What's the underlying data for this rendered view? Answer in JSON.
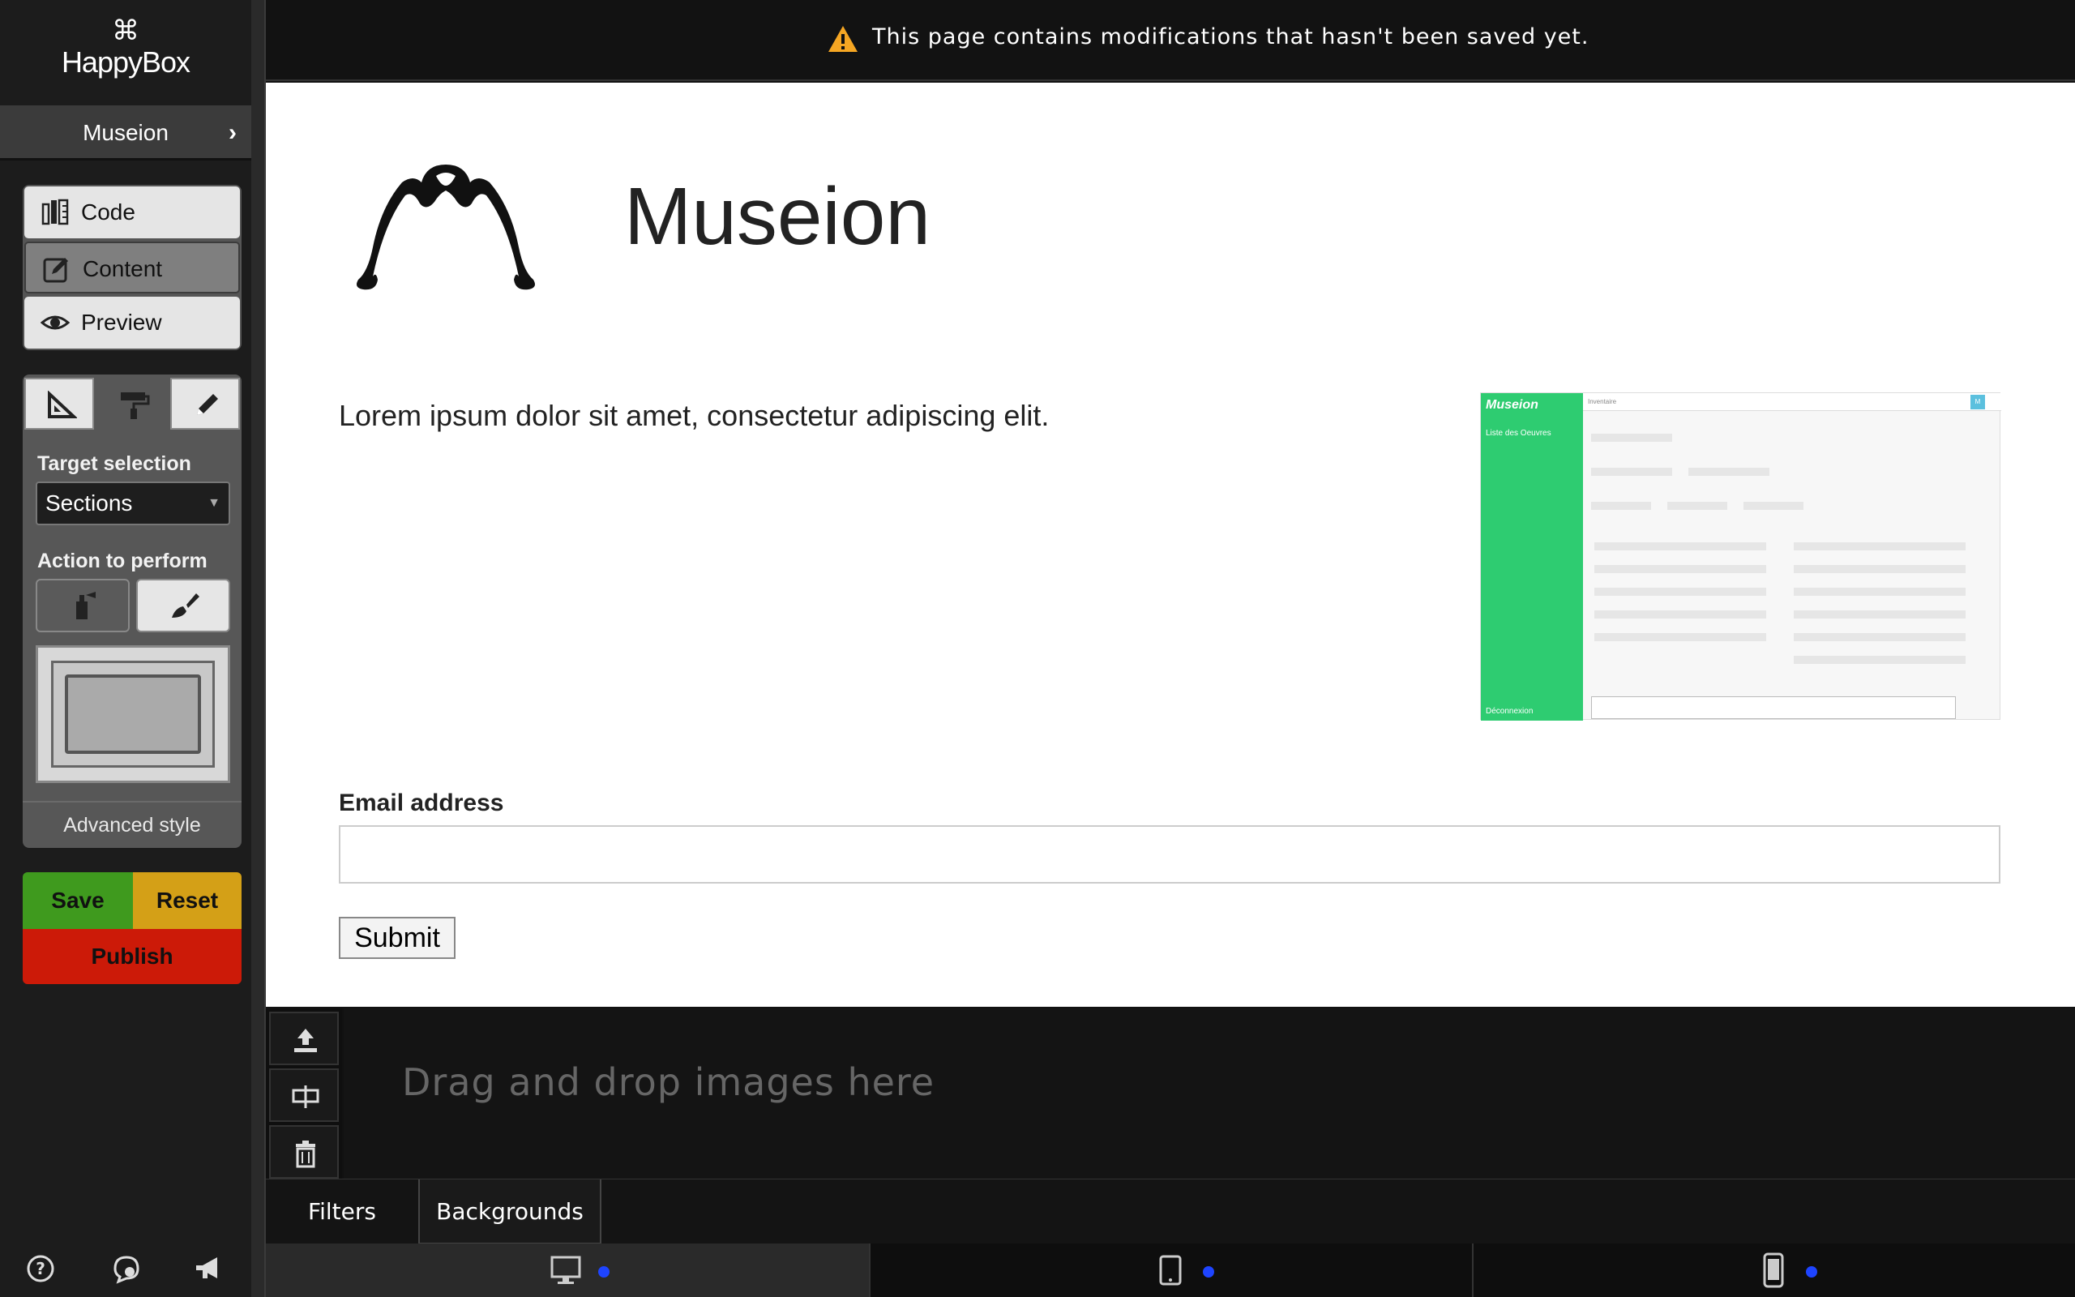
{
  "app": {
    "logo_text": "HappyBox",
    "logo_mark": "⌘"
  },
  "sidebar": {
    "site_name": "Museion",
    "site_chevron": "›",
    "modes": [
      {
        "label": "Code",
        "icon": "code-ruler-icon"
      },
      {
        "label": "Content",
        "icon": "edit-icon"
      },
      {
        "label": "Preview",
        "icon": "eye-icon"
      }
    ],
    "active_mode": "Content",
    "tool_tabs": [
      "set-square-icon",
      "paint-roller-icon",
      "pencil-icon"
    ],
    "target_selection_label": "Target selection",
    "target_selection_value": "Sections",
    "action_label": "Action to perform",
    "advanced_style_label": "Advanced style",
    "save_label": "Save",
    "reset_label": "Reset",
    "publish_label": "Publish",
    "footer_icons": [
      "help-icon",
      "chat-icon",
      "megaphone-icon"
    ]
  },
  "topbar": {
    "message": "This page contains modifications that hasn't been saved yet."
  },
  "page": {
    "title": "Museion",
    "paragraph": "Lorem ipsum dolor sit amet, consectetur adipiscing elit.",
    "thumbnail": {
      "brand": "Museion",
      "menu_item": "Liste des Oeuvres",
      "logout": "Déconnexion",
      "tab": "Inventaire",
      "badge": "M"
    },
    "email_label": "Email address",
    "email_value": "",
    "submit_label": "Submit"
  },
  "images": {
    "drop_text": "Drag and drop images here"
  },
  "bottom_tabs": [
    {
      "label": "Filters"
    },
    {
      "label": "Backgrounds"
    }
  ],
  "active_bottom_tab": "Backgrounds",
  "devices": [
    "desktop-icon",
    "tablet-icon",
    "phone-icon"
  ],
  "colors": {
    "save": "#3f9a1e",
    "reset": "#d4a017",
    "publish": "#cc1a08",
    "device_dot": "#1e44ff",
    "thumb_green": "#2ecc71"
  }
}
